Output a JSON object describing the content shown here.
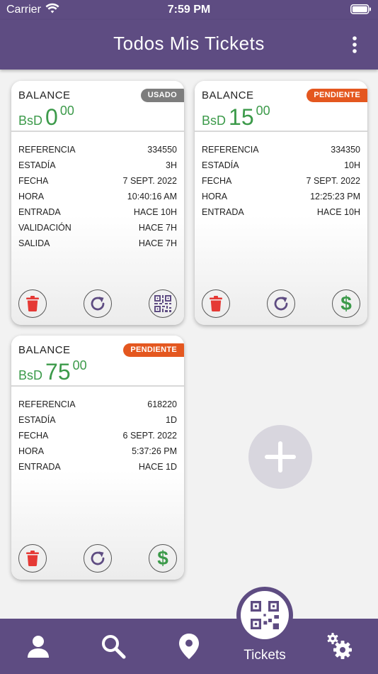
{
  "status": {
    "carrier": "Carrier",
    "time": "7:59 PM"
  },
  "header": {
    "title": "Todos Mis Tickets",
    "menu_icon": "more-vertical-icon"
  },
  "colors": {
    "brand": "#5e4c82",
    "amount_green": "#3c9a4a",
    "badge_pending": "#e4571f",
    "badge_used": "#7d7d7d",
    "delete_red": "#e53935"
  },
  "cards": [
    {
      "balance_label": "BALANCE",
      "currency": "BsD",
      "amount_int": "0",
      "amount_dec": "00",
      "badge": "USADO",
      "rows": [
        {
          "label": "REFERENCIA",
          "value": "334550"
        },
        {
          "label": "ESTADÍA",
          "value": "3H"
        },
        {
          "label": "FECHA",
          "value": "7 SEPT. 2022"
        },
        {
          "label": "HORA",
          "value": "10:40:16 AM"
        },
        {
          "label": "ENTRADA",
          "value": "HACE 10H"
        },
        {
          "label": "VALIDACIÓN",
          "value": "HACE 7H"
        },
        {
          "label": "SALIDA",
          "value": "HACE 7H"
        }
      ],
      "actions": [
        "trash-icon",
        "refresh-icon",
        "qr-code-icon"
      ]
    },
    {
      "balance_label": "BALANCE",
      "currency": "BsD",
      "amount_int": "15",
      "amount_dec": "00",
      "badge": "PENDIENTE",
      "rows": [
        {
          "label": "REFERENCIA",
          "value": "334350"
        },
        {
          "label": "ESTADÍA",
          "value": "10H"
        },
        {
          "label": "FECHA",
          "value": "7 SEPT. 2022"
        },
        {
          "label": "HORA",
          "value": "12:25:23 PM"
        },
        {
          "label": "ENTRADA",
          "value": "HACE 10H"
        }
      ],
      "actions": [
        "trash-icon",
        "refresh-icon",
        "dollar-icon"
      ]
    },
    {
      "balance_label": "BALANCE",
      "currency": "BsD",
      "amount_int": "75",
      "amount_dec": "00",
      "badge": "PENDIENTE",
      "rows": [
        {
          "label": "REFERENCIA",
          "value": "618220"
        },
        {
          "label": "ESTADÍA",
          "value": "1D"
        },
        {
          "label": "FECHA",
          "value": "6 SEPT. 2022"
        },
        {
          "label": "HORA",
          "value": "5:37:26 PM"
        },
        {
          "label": "ENTRADA",
          "value": "HACE 1D"
        }
      ],
      "actions": [
        "trash-icon",
        "refresh-icon",
        "dollar-icon"
      ]
    }
  ],
  "add_button": {
    "icon": "plus-icon"
  },
  "tabbar": {
    "active_label": "Tickets",
    "items": [
      "user-icon",
      "search-icon",
      "location-pin-icon",
      "qr-code-icon",
      "settings-gears-icon"
    ]
  }
}
